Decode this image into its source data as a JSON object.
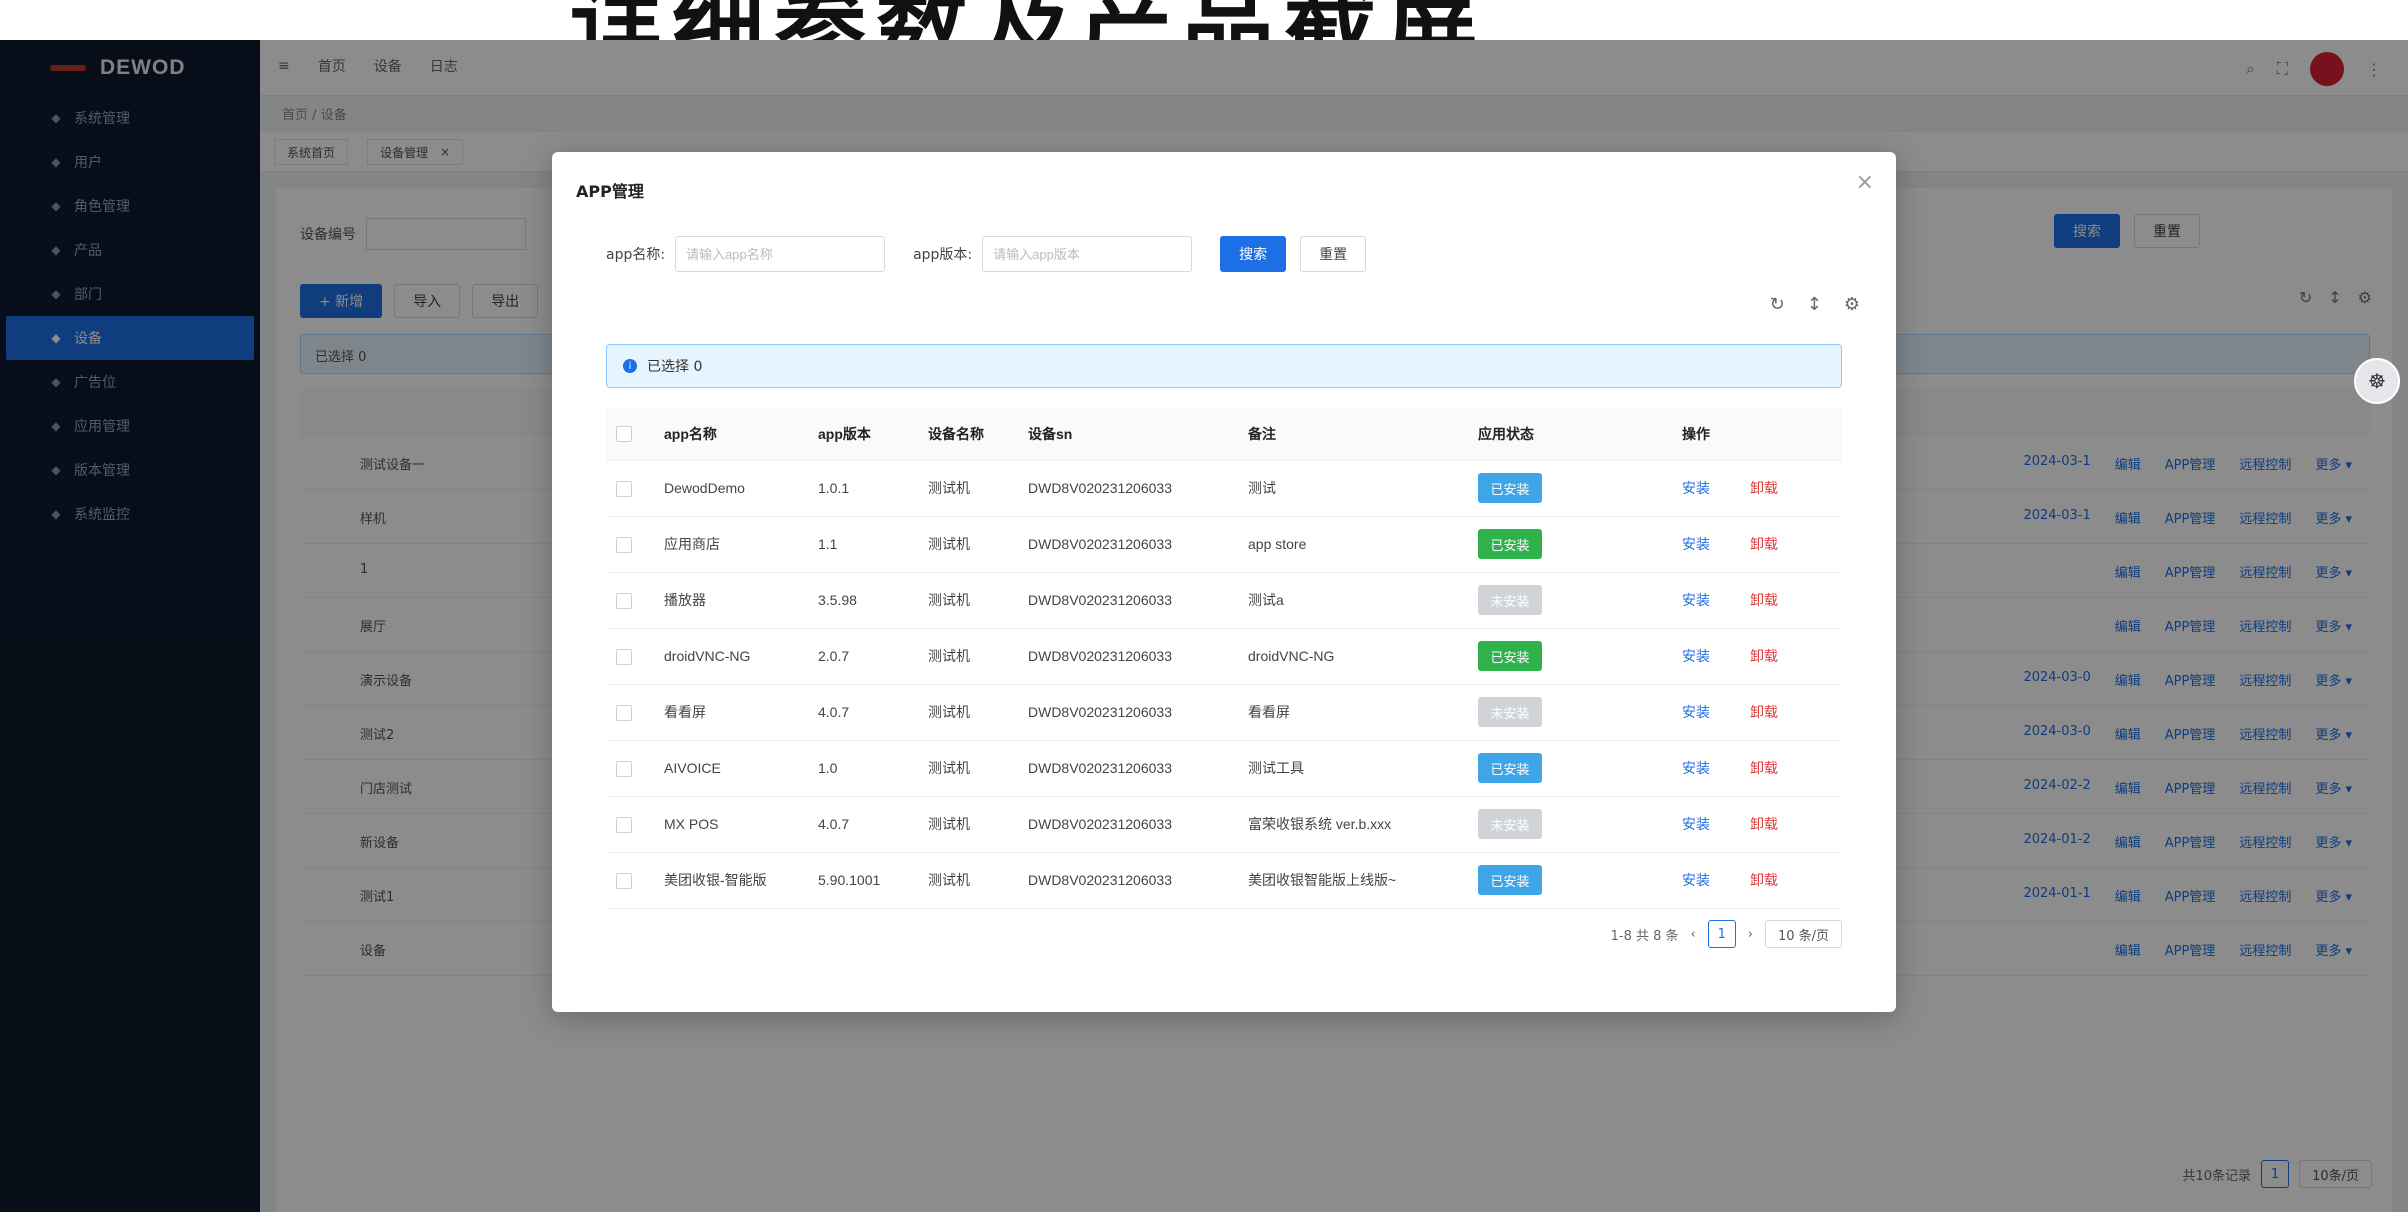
{
  "banner": {
    "title": "详细参数及产品截屏"
  },
  "app": {
    "logo_text": "DEWOD",
    "sidebar": [
      {
        "label": "系统管理",
        "icon": "settings-icon",
        "active": false
      },
      {
        "label": "用户",
        "icon": "user-icon",
        "active": false
      },
      {
        "label": "角色管理",
        "icon": "role-icon",
        "active": false
      },
      {
        "label": "产品",
        "icon": "product-icon",
        "active": false
      },
      {
        "label": "部门",
        "icon": "dept-icon",
        "active": false
      },
      {
        "label": "设备",
        "icon": "device-icon",
        "active": true
      },
      {
        "label": "广告位",
        "icon": "ad-icon",
        "active": false
      },
      {
        "label": "应用管理",
        "icon": "app-icon",
        "active": false
      },
      {
        "label": "版本管理",
        "icon": "version-icon",
        "active": false
      },
      {
        "label": "系统监控",
        "icon": "monitor-icon",
        "active": false
      }
    ],
    "topbar": {
      "menu_1": "首页",
      "menu_2": "设备",
      "menu_3": "日志"
    },
    "breadcrumb": "首页 / 设备",
    "tags": [
      "系统首页",
      "设备管理"
    ],
    "filter": {
      "label": "设备编号",
      "search": "搜索",
      "reset": "重置"
    },
    "toolbar": {
      "add": "+ 新增",
      "import": "导入",
      "export": "导出"
    },
    "selected_text": "已选择 0",
    "rows": [
      {
        "name": "测试设备一",
        "time": "2024-03-1"
      },
      {
        "name": "样机",
        "time": "2024-03-1"
      },
      {
        "name": "1",
        "time": ""
      },
      {
        "name": "展厅",
        "time": ""
      },
      {
        "name": "演示设备",
        "time": "2024-03-0"
      },
      {
        "name": "测试2",
        "time": "2024-03-0"
      },
      {
        "name": "门店测试",
        "time": "2024-02-2"
      },
      {
        "name": "新设备",
        "time": "2024-01-2"
      },
      {
        "name": "测试1",
        "time": "2024-01-1"
      },
      {
        "name": "设备",
        "time": ""
      }
    ],
    "ops": {
      "edit": "编辑",
      "app_manage": "APP管理",
      "dispatch": "远程控制",
      "more": "更多 ▾"
    },
    "pager": {
      "total": "共10条记录",
      "page": "1",
      "size": "10条/页"
    }
  },
  "modal": {
    "title": "APP管理",
    "app_name_label": "app名称:",
    "app_name_placeholder": "请输入app名称",
    "app_version_label": "app版本:",
    "app_version_placeholder": "请输入app版本",
    "search": "搜索",
    "reset": "重置",
    "selected_text": "已选择 0",
    "columns": [
      "app名称",
      "app版本",
      "设备名称",
      "设备sn",
      "备注",
      "应用状态",
      "操作"
    ],
    "rows": [
      {
        "name": "DewodDemo",
        "version": "1.0.1",
        "device": "测试机",
        "sn": "DWD8V020231206033",
        "remark": "测试",
        "status": "已安装",
        "status_color": "blue"
      },
      {
        "name": "应用商店",
        "version": "1.1",
        "device": "测试机",
        "sn": "DWD8V020231206033",
        "remark": "app store",
        "status": "已安装",
        "status_color": "green"
      },
      {
        "name": "播放器",
        "version": "3.5.98",
        "device": "测试机",
        "sn": "DWD8V020231206033",
        "remark": "测试a",
        "status": "未安装",
        "status_color": "gray"
      },
      {
        "name": "droidVNC-NG",
        "version": "2.0.7",
        "device": "测试机",
        "sn": "DWD8V020231206033",
        "remark": "droidVNC-NG",
        "status": "已安装",
        "status_color": "green"
      },
      {
        "name": "看看屏",
        "version": "4.0.7",
        "device": "测试机",
        "sn": "DWD8V020231206033",
        "remark": "看看屏",
        "status": "未安装",
        "status_color": "gray"
      },
      {
        "name": "AIVOICE",
        "version": "1.0",
        "device": "测试机",
        "sn": "DWD8V020231206033",
        "remark": "测试工具",
        "status": "已安装",
        "status_color": "blue"
      },
      {
        "name": "MX POS",
        "version": "4.0.7",
        "device": "测试机",
        "sn": "DWD8V020231206033",
        "remark": "富荣收银系统 ver.b.xxx",
        "status": "未安装",
        "status_color": "gray"
      },
      {
        "name": "美团收银-智能版",
        "version": "5.90.1001",
        "device": "测试机",
        "sn": "DWD8V020231206033",
        "remark": "美团收银智能版上线版~",
        "status": "已安装",
        "status_color": "blue"
      }
    ],
    "op_edit": "安装",
    "op_del": "卸载",
    "pager": {
      "total": "1-8 共 8 条",
      "page": "1",
      "size": "10 条/页"
    }
  }
}
